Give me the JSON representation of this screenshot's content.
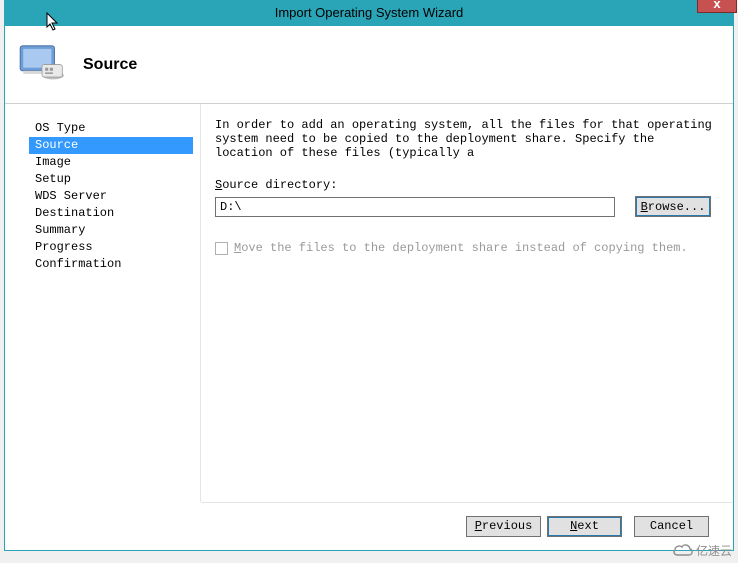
{
  "window": {
    "title": "Import Operating System Wizard",
    "close_symbol": "x"
  },
  "header": {
    "step_title": "Source"
  },
  "sidebar": {
    "items": [
      {
        "label": "OS Type"
      },
      {
        "label": "Source"
      },
      {
        "label": "Image"
      },
      {
        "label": "Setup"
      },
      {
        "label": "WDS Server"
      },
      {
        "label": "Destination"
      },
      {
        "label": "Summary"
      },
      {
        "label": "Progress"
      },
      {
        "label": "Confirmation"
      }
    ],
    "selected_index": 1
  },
  "main": {
    "instruction": "In order to add an operating system, all the files for that operating system need to be copied to the deployment share.  Specify the location of these files (typically a",
    "source_dir_label_pre": "S",
    "source_dir_label_rest": "ource directory:",
    "source_dir_value": "D:\\",
    "browse_label_pre": "B",
    "browse_label_rest": "rowse...",
    "move_checkbox_pre": "M",
    "move_checkbox_rest": "ove the files to the deployment share instead of copying them."
  },
  "footer": {
    "previous_pre": "P",
    "previous_rest": "revious",
    "next_pre": "N",
    "next_rest": "ext",
    "cancel": "Cancel"
  },
  "watermark": {
    "text": "亿速云"
  }
}
